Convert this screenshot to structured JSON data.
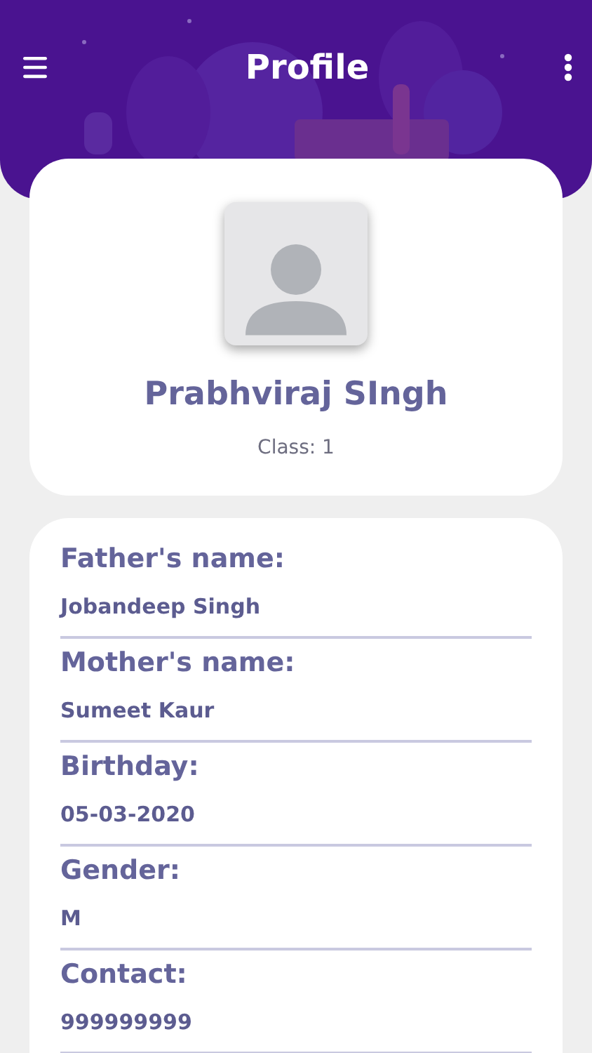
{
  "header": {
    "title": "Profile"
  },
  "profile": {
    "name": "Prabhviraj SIngh",
    "class": "Class: 1"
  },
  "details": [
    {
      "label": "Father's name:",
      "value": "Jobandeep Singh"
    },
    {
      "label": "Mother's name:",
      "value": "Sumeet Kaur"
    },
    {
      "label": "Birthday:",
      "value": "05-03-2020"
    },
    {
      "label": "Gender:",
      "value": "M"
    },
    {
      "label": "Contact:",
      "value": "999999999"
    }
  ]
}
